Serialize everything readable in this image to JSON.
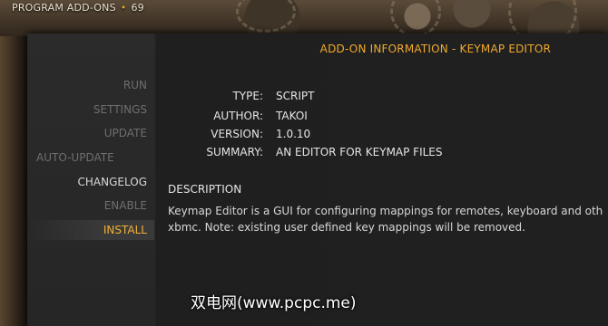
{
  "header": {
    "title": "PROGRAM ADD-ONS",
    "separator": "•",
    "count": "69"
  },
  "sidebar": {
    "items": [
      {
        "label": "RUN"
      },
      {
        "label": "SETTINGS"
      },
      {
        "label": "UPDATE"
      },
      {
        "label": "AUTO-UPDATE"
      },
      {
        "label": "CHANGELOG"
      },
      {
        "label": "ENABLE"
      },
      {
        "label": "INSTALL"
      }
    ]
  },
  "panel": {
    "title": "ADD-ON INFORMATION - KEYMAP EDITOR",
    "info": {
      "type_label": "TYPE:",
      "type_value": "SCRIPT",
      "author_label": "AUTHOR:",
      "author_value": "TAKOI",
      "version_label": "VERSION:",
      "version_value": "1.0.10",
      "summary_label": "SUMMARY:",
      "summary_value": "AN EDITOR FOR KEYMAP FILES"
    },
    "description_title": "DESCRIPTION",
    "description_line1": "Keymap Editor is a GUI for configuring mappings for remotes, keyboard and other",
    "description_line2": "xbmc. Note: existing user defined key mappings will be removed."
  },
  "watermark": "双电网(www.pcpc.me)",
  "colors": {
    "accent": "#f0aa2e",
    "panel": "#262626",
    "text": "#e5e5e5",
    "muted": "#6e6e6e"
  }
}
